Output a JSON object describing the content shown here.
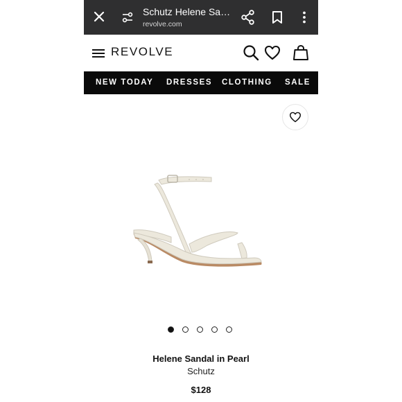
{
  "browser": {
    "title": "Schutz Helene San...",
    "url": "revolve.com",
    "icons": [
      "close-icon",
      "page-settings-icon",
      "share-icon",
      "bookmark-icon",
      "more-vert-icon"
    ]
  },
  "header": {
    "logo": "REVOLVE",
    "icons": [
      "hamburger-icon",
      "search-icon",
      "heart-icon",
      "shopping-bag-icon"
    ]
  },
  "nav": {
    "items": [
      "NEW TODAY",
      "DRESSES",
      "CLOTHING",
      "SALE"
    ]
  },
  "product": {
    "name": "Helene Sandal in Pearl",
    "brand": "Schutz",
    "price": "$128",
    "image_icon": "sandal-product-image",
    "carousel": {
      "total": 5,
      "active": 1
    }
  },
  "colors": {
    "browser_bar": "#2f2f30",
    "nav_bar": "#0a0a0a",
    "sandal": "#ece8dc",
    "heel_accent": "#b98a64"
  }
}
